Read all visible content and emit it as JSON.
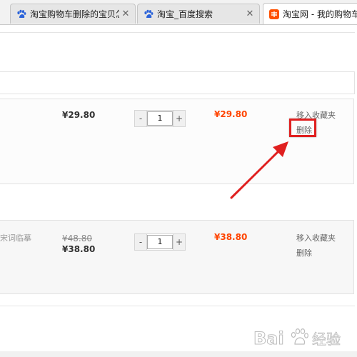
{
  "browser": {
    "tabs": [
      {
        "title": "淘宝购物车删除的宝贝怎",
        "icon": "baidu-paw-icon",
        "close": "✕",
        "active": false
      },
      {
        "title": "淘宝_百度搜索",
        "icon": "baidu-paw-icon",
        "close": "✕",
        "active": false
      },
      {
        "title": "淘宝网 - 我的购物车",
        "icon": "taobao-logo-icon",
        "close": "",
        "active": true
      }
    ]
  },
  "cart": {
    "items": [
      {
        "name_fragment": "",
        "price": "¥29.80",
        "original_price": "",
        "quantity": "1",
        "subtotal": "¥29.80",
        "actions": {
          "favorite": "移入收藏夹",
          "delete": "删除"
        }
      },
      {
        "name_fragment": "宋词临摹",
        "price": "¥38.80",
        "original_price": "¥48.80",
        "quantity": "1",
        "subtotal": "¥38.80",
        "actions": {
          "favorite": "移入收藏夹",
          "delete": "删除"
        }
      }
    ],
    "stepper": {
      "minus": "-",
      "plus": "+"
    }
  },
  "annotation": {
    "color": "#e02020"
  },
  "watermark": {
    "text": "Bai 经验",
    "color": "#999999"
  },
  "colors": {
    "accent_price": "#ff4400"
  }
}
